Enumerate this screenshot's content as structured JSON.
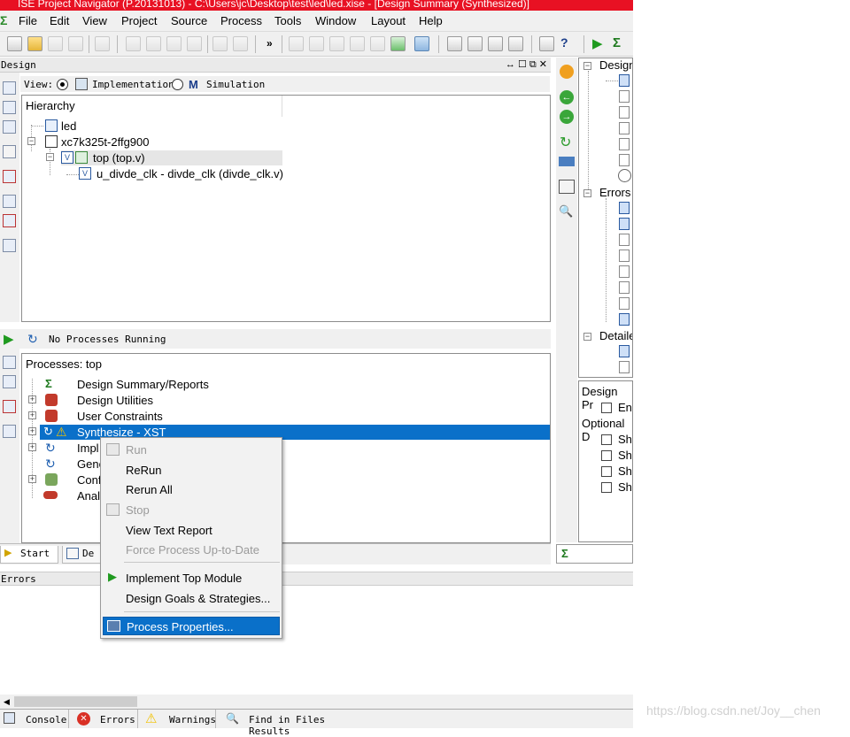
{
  "titlebar": {
    "text": "ISE Project Navigator (P.20131013) - C:\\Users\\jc\\Desktop\\test\\led\\led.xise - [Design Summary (Synthesized)]"
  },
  "menubar": {
    "items": [
      "File",
      "Edit",
      "View",
      "Project",
      "Source",
      "Process",
      "Tools",
      "Window",
      "Layout",
      "Help"
    ]
  },
  "design_panel": {
    "header": "Design",
    "view_label": "View:",
    "view_implementation": "Implementation",
    "view_simulation": "Simulation",
    "hierarchy_label": "Hierarchy",
    "tree": {
      "project": "led",
      "device": "xc7k325t-2ffg900",
      "top": "top (top.v)",
      "child": "u_divde_clk - divde_clk (divde_clk.v)"
    }
  },
  "process_panel": {
    "status": "No Processes Running",
    "label": "Processes: top",
    "items": [
      "Design Summary/Reports",
      "Design Utilities",
      "User Constraints",
      "Synthesize - XST",
      "Implement Design",
      "Generate Programming File",
      "Configure Target Device",
      "Analyze Design Using ChipScope"
    ],
    "items_visible": [
      "Design Summary/Reports",
      "Design Utilities",
      "User Constraints",
      "Synthesize - XST",
      "Impl",
      "Gene",
      "Conf",
      "Analy"
    ]
  },
  "bottom_tabs": {
    "start": "Start",
    "design": "De"
  },
  "context_menu": {
    "items": [
      "Run",
      "ReRun",
      "Rerun All",
      "Stop",
      "View Text Report",
      "Force Process Up-to-Date",
      "Implement Top Module",
      "Design Goals & Strategies...",
      "Process Properties..."
    ]
  },
  "right_panel": {
    "tree_labels": [
      "Design",
      "Errors",
      "Detaile"
    ],
    "props_title": "Design Pr",
    "props_row1": "Ena",
    "optional": "Optional D",
    "show_rows": [
      "Sho",
      "Sho",
      "Sho",
      "Sho"
    ]
  },
  "errors_header": "Errors",
  "status_tabs": {
    "console": "Console",
    "errors": "Errors",
    "warnings": "Warnings",
    "find": "Find in Files Results"
  },
  "watermark": "https://blog.csdn.net/Joy__chen"
}
